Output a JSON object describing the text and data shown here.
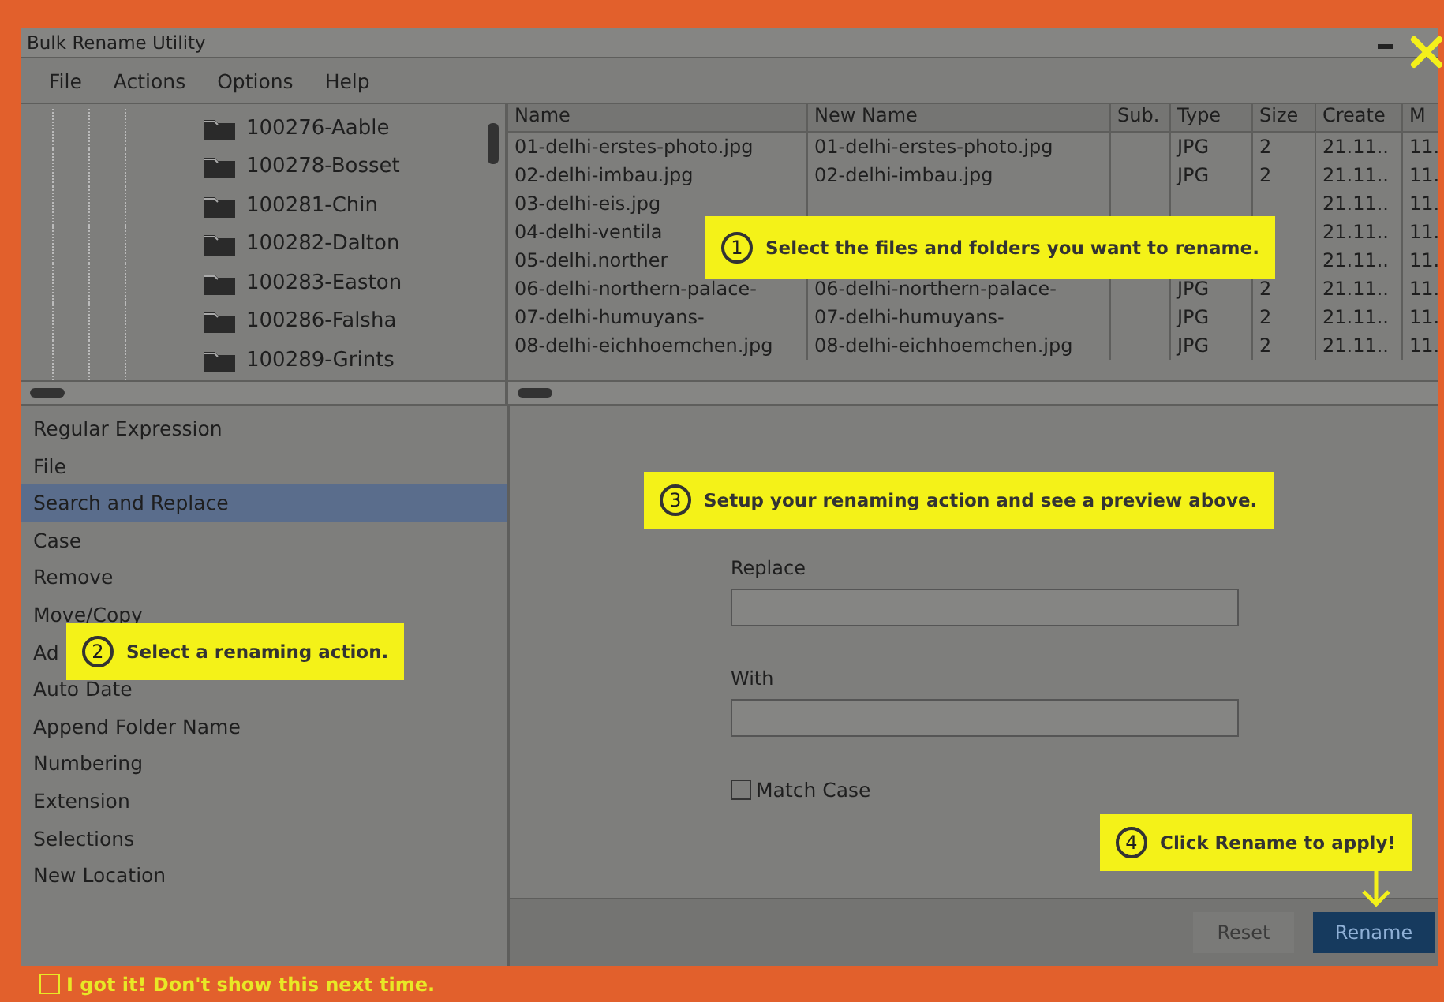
{
  "window": {
    "title": "Bulk Rename Utility"
  },
  "menu": [
    "File",
    "Actions",
    "Options",
    "Help"
  ],
  "folders": [
    "100276-Aable",
    "100278-Bosset",
    "100281-Chin",
    "100282-Dalton",
    "100283-Easton",
    "100286-Falsha",
    "100289-Grints"
  ],
  "files": {
    "columns": [
      "Name",
      "New Name",
      "Sub.",
      "Type",
      "Size",
      "Create",
      "M"
    ],
    "rows": [
      {
        "name": "01-delhi-erstes-photo.jpg",
        "new_name": "01-delhi-erstes-photo.jpg",
        "type": "JPG",
        "size": "2",
        "created": "21.11..",
        "m": "11."
      },
      {
        "name": "02-delhi-imbau.jpg",
        "new_name": "02-delhi-imbau.jpg",
        "type": "JPG",
        "size": "2",
        "created": "21.11..",
        "m": "11."
      },
      {
        "name": "03-delhi-eis.jpg",
        "created": "21.11..",
        "m": "11."
      },
      {
        "name": "04-delhi-ventila",
        "created": "21.11..",
        "m": "11."
      },
      {
        "name": "05-delhi.norther",
        "created": "21.11..",
        "m": "11."
      },
      {
        "name": "06-delhi-northern-palace-",
        "new_name": "06-delhi-northern-palace-",
        "type": "JPG",
        "size": "2",
        "created": "21.11..",
        "m": "11."
      },
      {
        "name": "07-delhi-humuyans-",
        "new_name": "07-delhi-humuyans-",
        "type": "JPG",
        "size": "2",
        "created": "21.11..",
        "m": "11."
      },
      {
        "name": "08-delhi-eichhoemchen.jpg",
        "new_name": "08-delhi-eichhoemchen.jpg",
        "type": "JPG",
        "size": "2",
        "created": "21.11..",
        "m": "11."
      }
    ]
  },
  "actions": [
    {
      "label": "Regular Expression",
      "selected": false
    },
    {
      "label": "File",
      "selected": false
    },
    {
      "label": "Search and Replace",
      "selected": true
    },
    {
      "label": "Case",
      "selected": false
    },
    {
      "label": "Remove",
      "selected": false
    },
    {
      "label": "Move/Copy",
      "selected": false
    },
    {
      "label": "Ad",
      "selected": false
    },
    {
      "label": "Auto Date",
      "selected": false
    },
    {
      "label": "Append Folder Name",
      "selected": false
    },
    {
      "label": "Numbering",
      "selected": false
    },
    {
      "label": "Extension",
      "selected": false
    },
    {
      "label": "Selections",
      "selected": false
    },
    {
      "label": "New Location",
      "selected": false
    }
  ],
  "form": {
    "fields": [
      {
        "label": "Replace"
      },
      {
        "label": "With"
      }
    ],
    "checkbox": {
      "label": "Match Case",
      "checked": false
    }
  },
  "buttons": [
    {
      "label": "Reset",
      "kind": "secondary",
      "disabled": true
    },
    {
      "label": "Rename",
      "kind": "primary",
      "disabled": false
    }
  ],
  "callouts": [
    {
      "number": "1",
      "text": "Select the files and folders you want to rename."
    },
    {
      "number": "2",
      "text": "Select a renaming action."
    },
    {
      "number": "3",
      "text": "Setup your renaming action and see a preview above."
    },
    {
      "number": "4",
      "text": "Click Rename to apply!",
      "arrow": true
    }
  ],
  "dont_show": {
    "label": "I got it! Don't show this next time.",
    "checked": false
  }
}
